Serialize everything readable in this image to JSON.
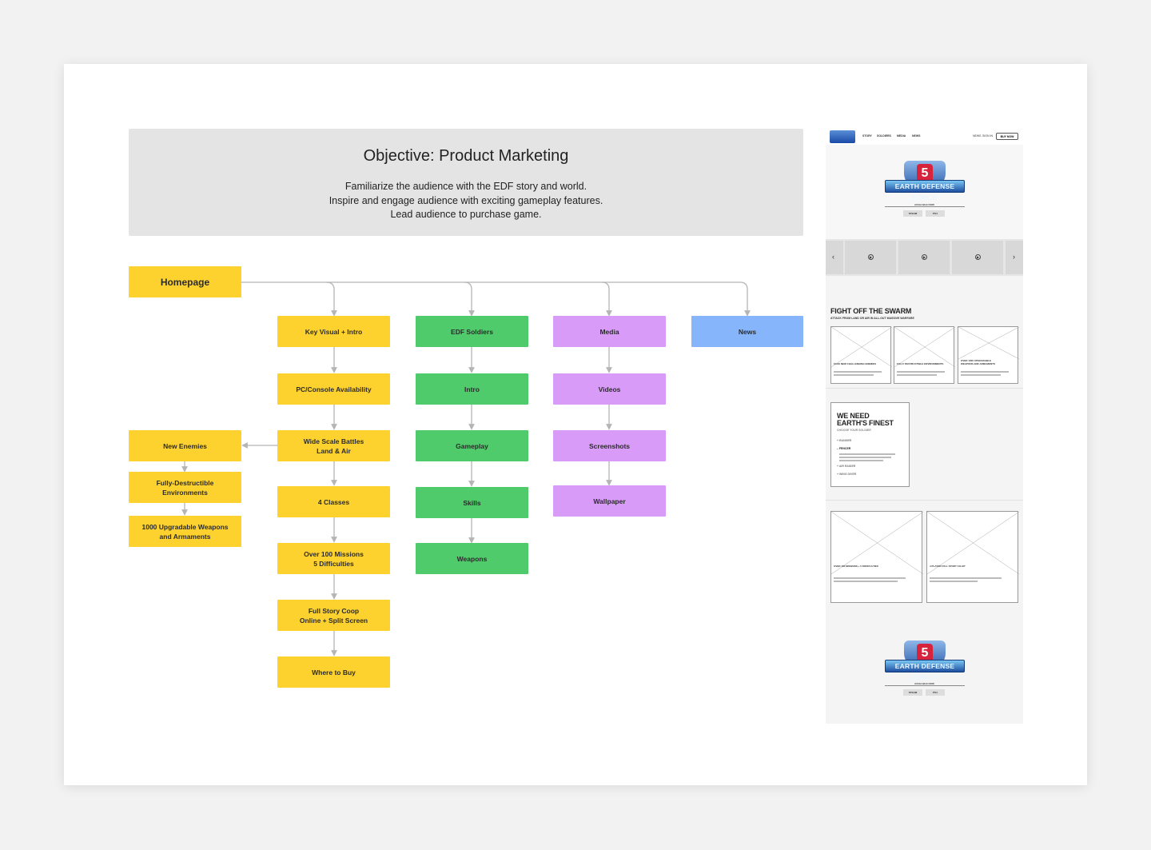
{
  "objective": {
    "title": "Objective: Product Marketing",
    "lines": [
      "Familiarize the audience with the EDF story and world.",
      "Inspire and engage audience with exciting gameplay features.",
      "Lead audience to purchase game."
    ]
  },
  "sitemap": {
    "root": "Homepage",
    "col_key_visual": [
      "Key Visual + Intro",
      "PC/Console Availability",
      "Wide Scale Battles\nLand & Air",
      "4 Classes",
      "Over 100 Missions\n5 Difficulties",
      "Full Story Coop\nOnline + Split Screen",
      "Where to Buy"
    ],
    "col_side": [
      "New Enemies",
      "Fully-Destructible\nEnvironments",
      "1000 Upgradable Weapons\nand Armaments"
    ],
    "col_soldiers": [
      "EDF Soldiers",
      "Intro",
      "Gameplay",
      "Skills",
      "Weapons"
    ],
    "col_media": [
      "Media",
      "Videos",
      "Screenshots",
      "Wallpaper"
    ],
    "col_news": [
      "News"
    ],
    "colors": {
      "yellow": "#fdd22e",
      "green": "#4fcb6c",
      "purple": "#d89bf7",
      "blue": "#86b5fb",
      "connector": "#b5b5b5"
    }
  },
  "wireframe": {
    "nav": [
      "STORY",
      "SOLDIERS",
      "MEDIA",
      "NEWS"
    ],
    "nav_right": [
      "NEWS",
      "SIGN IN"
    ],
    "buy_now": "BUY NOW",
    "logo_text": "EARTH DEFENSE FORCE",
    "logo_number": "5",
    "available_now": "AVAILABLE NOW",
    "platforms": [
      "STEAM",
      "PS4"
    ],
    "arrows": {
      "left": "‹",
      "right": "›",
      "play": "▶"
    },
    "swarm_title": "FIGHT OFF THE SWARM",
    "swarm_sub": "ATTACK FROM LAND OR AIR IN ALL-OUT MASSIVE WARFARE",
    "swarm_cards": [
      "FACE NEW CHALLENGING ENEMIES",
      "FULLY DESTRUCTIBLE ENVIRONMENTS",
      "OVER 1000 UPGRADABLE\nWEAPONS AND ARMAMENTS"
    ],
    "soldier_title_1": "WE NEED",
    "soldier_title_2": "EARTH'S FINEST",
    "soldier_sub": "CHOOSE YOUR SOLDIER",
    "soldier_classes": [
      "+ RANGER",
      "– FENCER",
      "+ AIR RAIDER",
      "+ WING DIVER"
    ],
    "mission_cards": [
      "OVER 100 MISSIONS + 5 DIFFICULTIES",
      "4 PLAYER FULL STORY CO-OP"
    ]
  }
}
